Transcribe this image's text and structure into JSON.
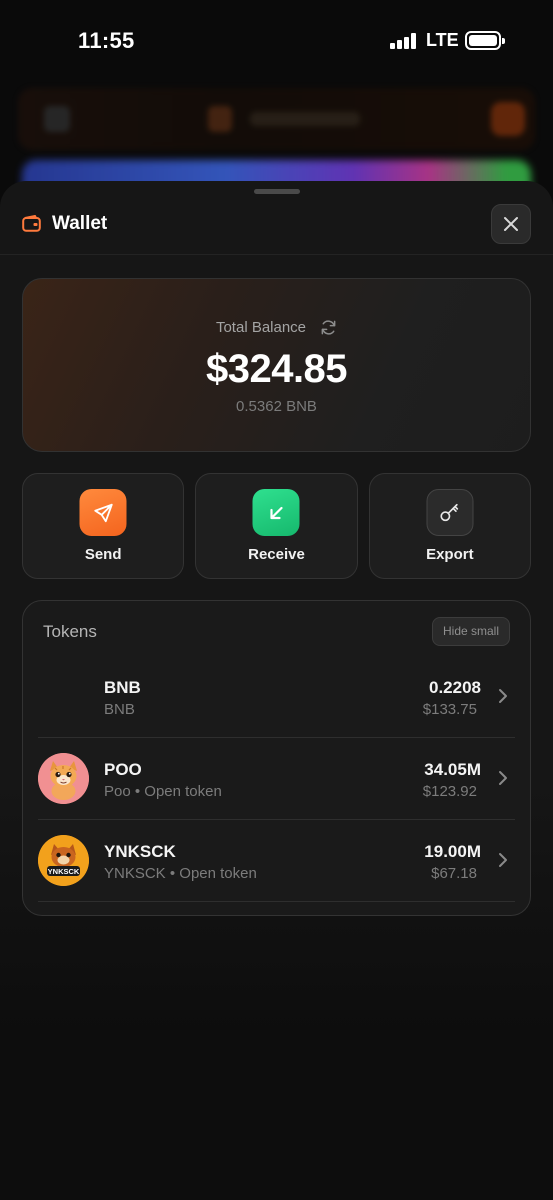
{
  "status_bar": {
    "time": "11:55",
    "network": "LTE"
  },
  "sheet": {
    "title": "Wallet"
  },
  "balance": {
    "label": "Total Balance",
    "amount": "$324.85",
    "sub": "0.5362 BNB"
  },
  "actions": [
    {
      "label": "Send",
      "icon": "send-icon"
    },
    {
      "label": "Receive",
      "icon": "receive-icon"
    },
    {
      "label": "Export",
      "icon": "key-icon"
    }
  ],
  "tokens": {
    "title": "Tokens",
    "hide_small_label": "Hide small",
    "items": [
      {
        "name": "BNB",
        "sub": "BNB",
        "amount": "0.2208",
        "value": "$133.75",
        "avatar": "none"
      },
      {
        "name": "POO",
        "sub": "Poo • Open token",
        "amount": "34.05M",
        "value": "$123.92",
        "avatar": "cat-avatar"
      },
      {
        "name": "YNKSCK",
        "sub": "YNKSCK • Open token",
        "amount": "19.00M",
        "value": "$67.18",
        "avatar": "ynksck-logo"
      }
    ]
  },
  "colors": {
    "send": "#F4641E",
    "receive": "#16B86D",
    "accent": "#FF7A3D"
  }
}
